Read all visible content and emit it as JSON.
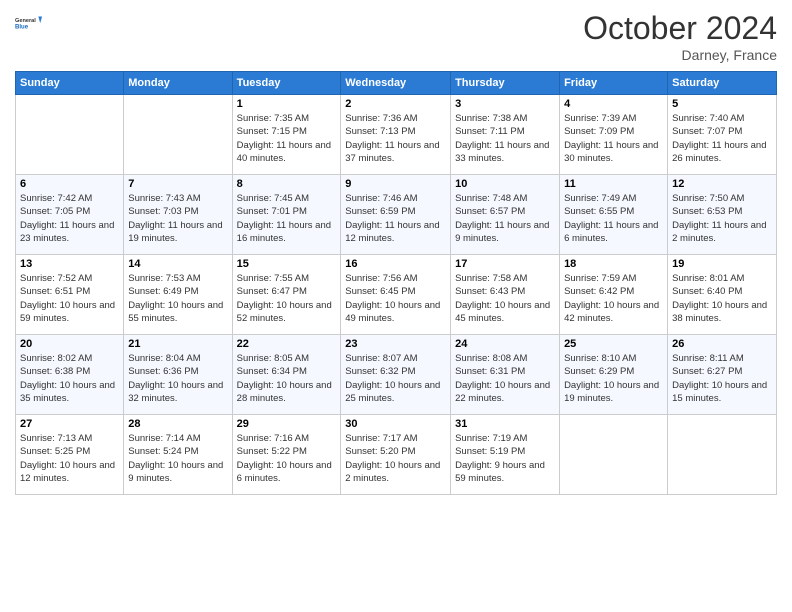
{
  "header": {
    "logo_line1": "General",
    "logo_line2": "Blue",
    "month": "October 2024",
    "location": "Darney, France"
  },
  "days_of_week": [
    "Sunday",
    "Monday",
    "Tuesday",
    "Wednesday",
    "Thursday",
    "Friday",
    "Saturday"
  ],
  "weeks": [
    [
      {
        "day": "",
        "info": ""
      },
      {
        "day": "",
        "info": ""
      },
      {
        "day": "1",
        "info": "Sunrise: 7:35 AM\nSunset: 7:15 PM\nDaylight: 11 hours and 40 minutes."
      },
      {
        "day": "2",
        "info": "Sunrise: 7:36 AM\nSunset: 7:13 PM\nDaylight: 11 hours and 37 minutes."
      },
      {
        "day": "3",
        "info": "Sunrise: 7:38 AM\nSunset: 7:11 PM\nDaylight: 11 hours and 33 minutes."
      },
      {
        "day": "4",
        "info": "Sunrise: 7:39 AM\nSunset: 7:09 PM\nDaylight: 11 hours and 30 minutes."
      },
      {
        "day": "5",
        "info": "Sunrise: 7:40 AM\nSunset: 7:07 PM\nDaylight: 11 hours and 26 minutes."
      }
    ],
    [
      {
        "day": "6",
        "info": "Sunrise: 7:42 AM\nSunset: 7:05 PM\nDaylight: 11 hours and 23 minutes."
      },
      {
        "day": "7",
        "info": "Sunrise: 7:43 AM\nSunset: 7:03 PM\nDaylight: 11 hours and 19 minutes."
      },
      {
        "day": "8",
        "info": "Sunrise: 7:45 AM\nSunset: 7:01 PM\nDaylight: 11 hours and 16 minutes."
      },
      {
        "day": "9",
        "info": "Sunrise: 7:46 AM\nSunset: 6:59 PM\nDaylight: 11 hours and 12 minutes."
      },
      {
        "day": "10",
        "info": "Sunrise: 7:48 AM\nSunset: 6:57 PM\nDaylight: 11 hours and 9 minutes."
      },
      {
        "day": "11",
        "info": "Sunrise: 7:49 AM\nSunset: 6:55 PM\nDaylight: 11 hours and 6 minutes."
      },
      {
        "day": "12",
        "info": "Sunrise: 7:50 AM\nSunset: 6:53 PM\nDaylight: 11 hours and 2 minutes."
      }
    ],
    [
      {
        "day": "13",
        "info": "Sunrise: 7:52 AM\nSunset: 6:51 PM\nDaylight: 10 hours and 59 minutes."
      },
      {
        "day": "14",
        "info": "Sunrise: 7:53 AM\nSunset: 6:49 PM\nDaylight: 10 hours and 55 minutes."
      },
      {
        "day": "15",
        "info": "Sunrise: 7:55 AM\nSunset: 6:47 PM\nDaylight: 10 hours and 52 minutes."
      },
      {
        "day": "16",
        "info": "Sunrise: 7:56 AM\nSunset: 6:45 PM\nDaylight: 10 hours and 49 minutes."
      },
      {
        "day": "17",
        "info": "Sunrise: 7:58 AM\nSunset: 6:43 PM\nDaylight: 10 hours and 45 minutes."
      },
      {
        "day": "18",
        "info": "Sunrise: 7:59 AM\nSunset: 6:42 PM\nDaylight: 10 hours and 42 minutes."
      },
      {
        "day": "19",
        "info": "Sunrise: 8:01 AM\nSunset: 6:40 PM\nDaylight: 10 hours and 38 minutes."
      }
    ],
    [
      {
        "day": "20",
        "info": "Sunrise: 8:02 AM\nSunset: 6:38 PM\nDaylight: 10 hours and 35 minutes."
      },
      {
        "day": "21",
        "info": "Sunrise: 8:04 AM\nSunset: 6:36 PM\nDaylight: 10 hours and 32 minutes."
      },
      {
        "day": "22",
        "info": "Sunrise: 8:05 AM\nSunset: 6:34 PM\nDaylight: 10 hours and 28 minutes."
      },
      {
        "day": "23",
        "info": "Sunrise: 8:07 AM\nSunset: 6:32 PM\nDaylight: 10 hours and 25 minutes."
      },
      {
        "day": "24",
        "info": "Sunrise: 8:08 AM\nSunset: 6:31 PM\nDaylight: 10 hours and 22 minutes."
      },
      {
        "day": "25",
        "info": "Sunrise: 8:10 AM\nSunset: 6:29 PM\nDaylight: 10 hours and 19 minutes."
      },
      {
        "day": "26",
        "info": "Sunrise: 8:11 AM\nSunset: 6:27 PM\nDaylight: 10 hours and 15 minutes."
      }
    ],
    [
      {
        "day": "27",
        "info": "Sunrise: 7:13 AM\nSunset: 5:25 PM\nDaylight: 10 hours and 12 minutes."
      },
      {
        "day": "28",
        "info": "Sunrise: 7:14 AM\nSunset: 5:24 PM\nDaylight: 10 hours and 9 minutes."
      },
      {
        "day": "29",
        "info": "Sunrise: 7:16 AM\nSunset: 5:22 PM\nDaylight: 10 hours and 6 minutes."
      },
      {
        "day": "30",
        "info": "Sunrise: 7:17 AM\nSunset: 5:20 PM\nDaylight: 10 hours and 2 minutes."
      },
      {
        "day": "31",
        "info": "Sunrise: 7:19 AM\nSunset: 5:19 PM\nDaylight: 9 hours and 59 minutes."
      },
      {
        "day": "",
        "info": ""
      },
      {
        "day": "",
        "info": ""
      }
    ]
  ]
}
